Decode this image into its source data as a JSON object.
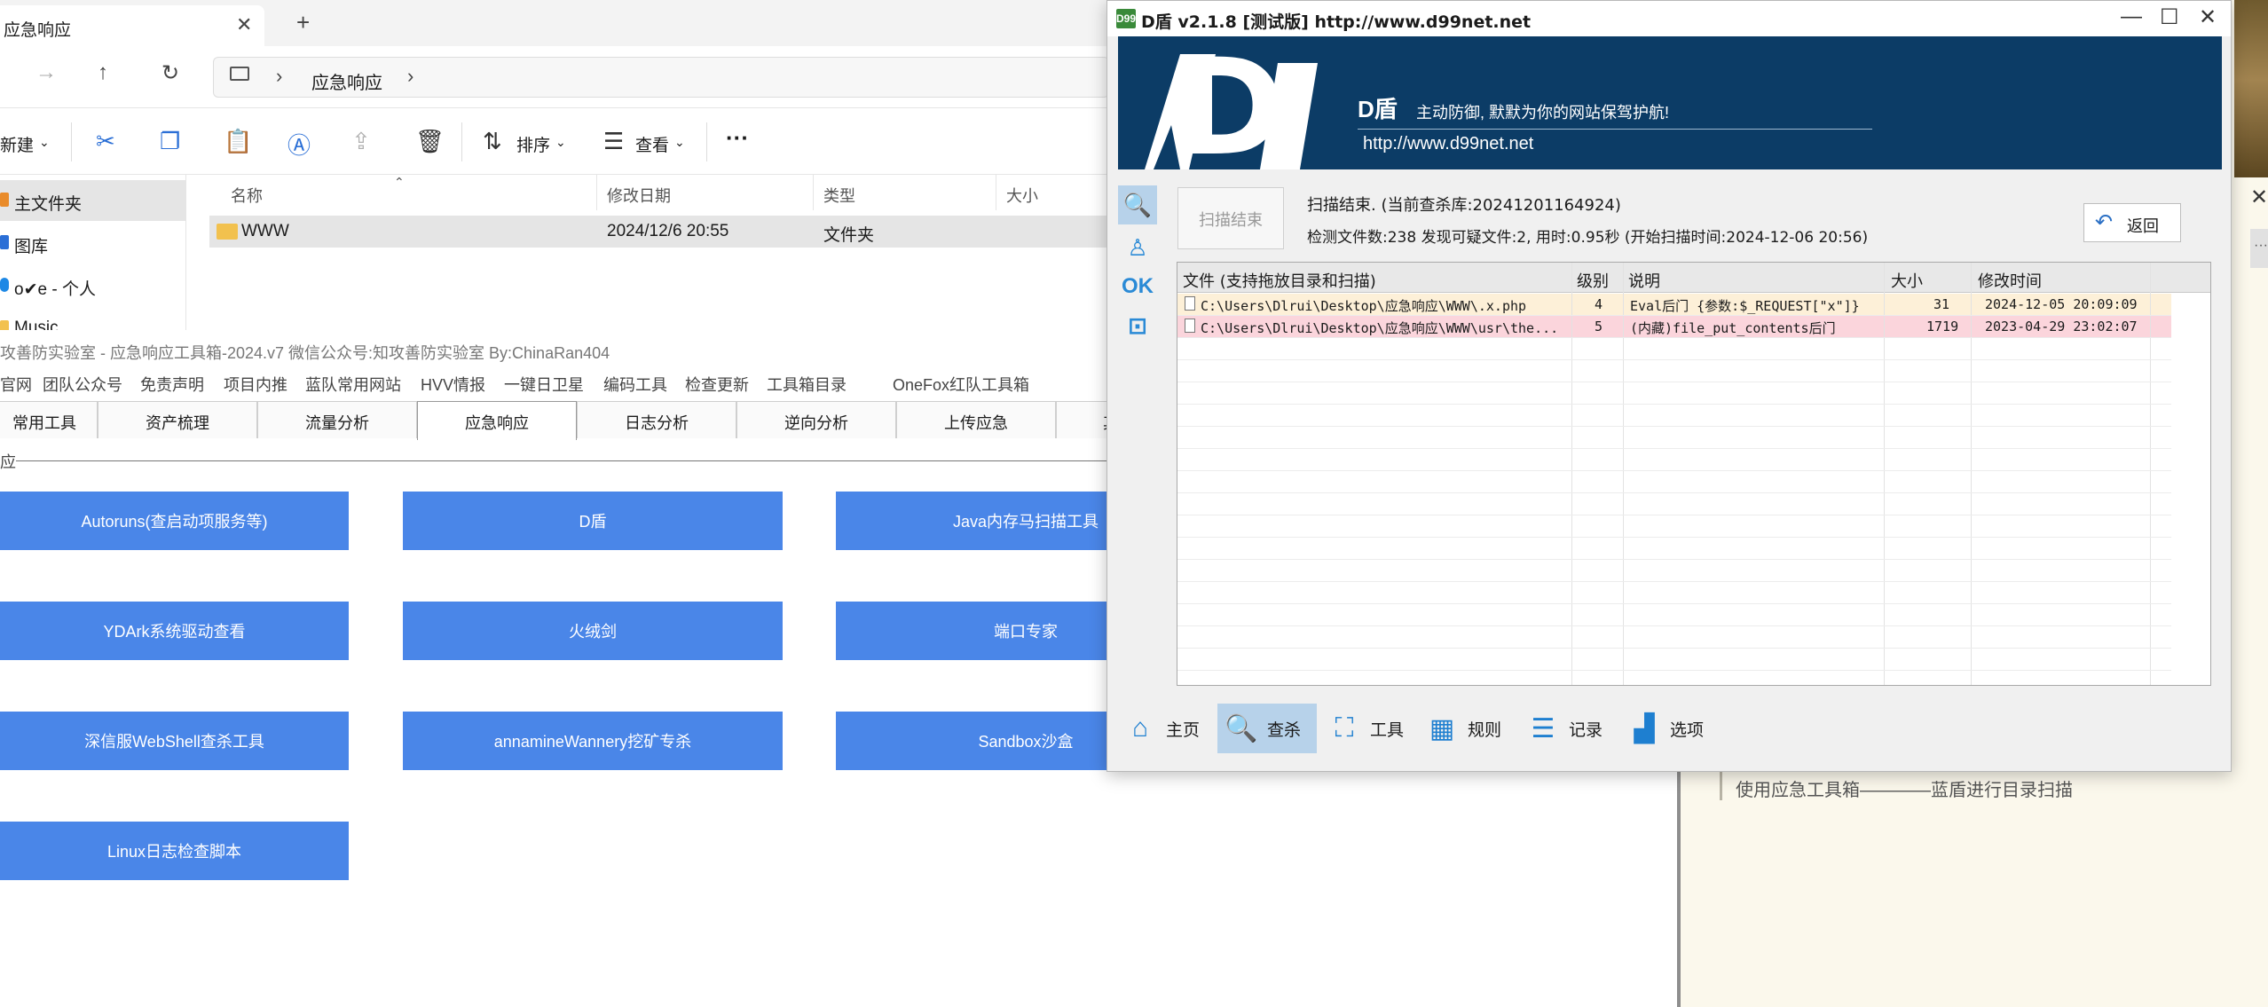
{
  "explorer": {
    "tab_title": "应急响应",
    "tab_close": "✕",
    "new_tab": "+",
    "nav": {
      "forward": "→",
      "up": "↑",
      "refresh": "↻"
    },
    "address": {
      "crumb": "应急响应",
      "separator": "›"
    },
    "commands": {
      "new_label": "新建",
      "sort_label": "排序",
      "view_label": "查看",
      "more": "···",
      "chevron": "⌄"
    },
    "sidebar": [
      {
        "label": "主文件夹"
      },
      {
        "label": "图库"
      },
      {
        "label": "o✔e - 个人"
      },
      {
        "label": "Music"
      }
    ],
    "columns": {
      "name": "名称",
      "date": "修改日期",
      "type": "类型",
      "size": "大小"
    },
    "files": [
      {
        "name": "WWW",
        "date": "2024/12/6 20:55",
        "type": "文件夹"
      }
    ]
  },
  "toolbox": {
    "title": "攻善防实验室 - 应急响应工具箱-2024.v7    微信公众号:知攻善防实验室    By:ChinaRan404",
    "menu": [
      "官网",
      "团队公众号",
      "免责声明",
      "项目内推",
      "蓝队常用网站",
      "HVV情报",
      "一键日卫星",
      "编码工具",
      "检查更新",
      "工具箱目录",
      "OneFox红队工具箱"
    ],
    "tabs": [
      "常用工具",
      "资产梳理",
      "流量分析",
      "应急响应",
      "日志分析",
      "逆向分析",
      "上传应急",
      "其"
    ],
    "active_tab": "应急响应",
    "group_label": "应",
    "tools": [
      "Autoruns(查启动项服务等)",
      "D盾",
      "Java内存马扫描工具",
      "YDArk系统驱动查看",
      "火绒剑",
      "端口专家",
      "深信服WebShell查杀工具",
      "annamineWannery挖矿专杀",
      "Sandbox沙盒",
      "Linux日志检查脚本"
    ]
  },
  "dshield": {
    "title": "D盾 v2.1.8 [测试版] http://www.d99net.net",
    "title_icon": "D99",
    "window_buttons": {
      "minimize": "—",
      "maximize": "☐",
      "close": "✕"
    },
    "banner": {
      "logo": "D",
      "brand": "D盾",
      "slogan": "主动防御, 默默为你的网站保驾护航!",
      "url": "http://www.d99net.net"
    },
    "side_icons": {
      "search": "🔍",
      "user": "♙",
      "ok": "OK",
      "box": "⊡"
    },
    "scan_button": "扫描结束",
    "status_line1": "扫描结束. (当前查杀库:20241201164924)",
    "status_line2": "检测文件数:238 发现可疑文件:2, 用时:0.95秒 (开始扫描时间:2024-12-06 20:56)",
    "back_label": "返回",
    "back_icon": "↶",
    "grid": {
      "headers": {
        "file": "文件 (支持拖放目录和扫描)",
        "level": "级别",
        "desc": "说明",
        "size": "大小",
        "mtime": "修改时间"
      },
      "rows": [
        {
          "file": "C:\\Users\\Dlrui\\Desktop\\应急响应\\WWW\\.x.php",
          "level": "4",
          "desc": "Eval后门 {参数:$_REQUEST[\"x\"]}",
          "size": "31",
          "mtime": "2024-12-05 20:09:09",
          "bg": "#fdf0d8"
        },
        {
          "file": "C:\\Users\\Dlrui\\Desktop\\应急响应\\WWW\\usr\\the...",
          "level": "5",
          "desc": "(内藏)file_put_contents后门",
          "size": "1719",
          "mtime": "2023-04-29 23:02:07",
          "bg": "#fbd5dc"
        }
      ]
    },
    "bottom_nav": [
      {
        "label": "主页",
        "icon": "⌂"
      },
      {
        "label": "查杀",
        "icon": "🔍"
      },
      {
        "label": "工具",
        "icon": "⛶"
      },
      {
        "label": "规则",
        "icon": "▦"
      },
      {
        "label": "记录",
        "icon": "☰"
      },
      {
        "label": "选项",
        "icon": "▟"
      }
    ]
  },
  "right_panel": {
    "close": "✕",
    "more": "···",
    "note": "使用应急工具箱————蓝盾进行目录扫描"
  },
  "colors": {
    "tool_button": "#4a86e8",
    "banner": "#0c3c66",
    "row_warn": "#fdf0d8",
    "row_danger": "#fbd5dc",
    "accent": "#1e7fd0"
  }
}
